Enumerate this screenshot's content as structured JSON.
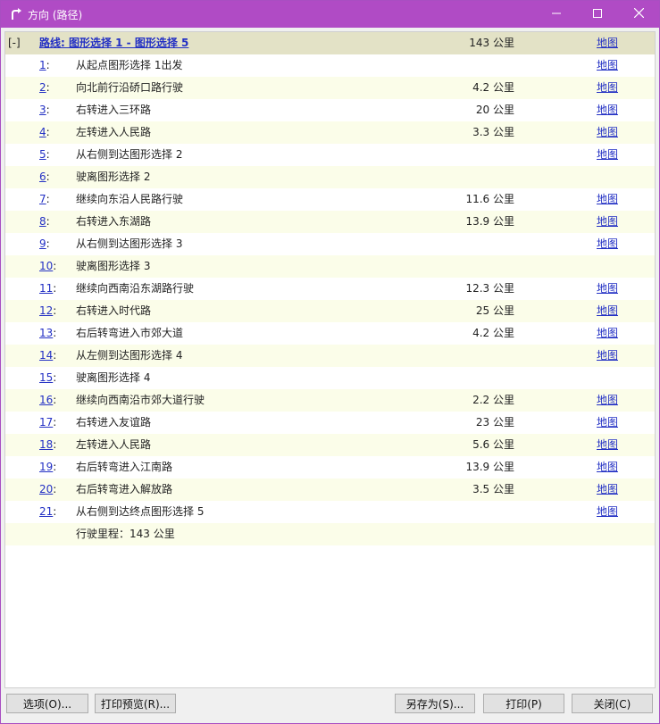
{
  "window": {
    "title": "方向 (路径)",
    "accent_color": "#b04bc5",
    "icons": {
      "app": "turn-arrow-icon",
      "minimize": "minimize-icon",
      "maximize": "maximize-icon",
      "close": "close-icon"
    }
  },
  "route": {
    "toggle": "[-]",
    "title": "路线: 图形选择 1 - 图形选择 5",
    "distance": "143 公里",
    "map_label": "地图"
  },
  "steps": [
    {
      "num": "1",
      "text": "从起点图形选择 1出发",
      "dist": "",
      "map": "地图"
    },
    {
      "num": "2",
      "text": "向北前行沿硚口路行驶",
      "dist": "4.2 公里",
      "map": "地图"
    },
    {
      "num": "3",
      "text": "右转进入三环路",
      "dist": "20 公里",
      "map": "地图"
    },
    {
      "num": "4",
      "text": "左转进入人民路",
      "dist": "3.3 公里",
      "map": "地图"
    },
    {
      "num": "5",
      "text": "从右侧到达图形选择 2",
      "dist": "",
      "map": "地图"
    },
    {
      "num": "6",
      "text": "驶离图形选择 2",
      "dist": "",
      "map": ""
    },
    {
      "num": "7",
      "text": "继续向东沿人民路行驶",
      "dist": "11.6 公里",
      "map": "地图"
    },
    {
      "num": "8",
      "text": "右转进入东湖路",
      "dist": "13.9 公里",
      "map": "地图"
    },
    {
      "num": "9",
      "text": "从右侧到达图形选择 3",
      "dist": "",
      "map": "地图"
    },
    {
      "num": "10",
      "text": "驶离图形选择 3",
      "dist": "",
      "map": ""
    },
    {
      "num": "11",
      "text": "继续向西南沿东湖路行驶",
      "dist": "12.3 公里",
      "map": "地图"
    },
    {
      "num": "12",
      "text": "右转进入时代路",
      "dist": "25 公里",
      "map": "地图"
    },
    {
      "num": "13",
      "text": "右后转弯进入市郊大道",
      "dist": "4.2 公里",
      "map": "地图"
    },
    {
      "num": "14",
      "text": "从左侧到达图形选择 4",
      "dist": "",
      "map": "地图"
    },
    {
      "num": "15",
      "text": "驶离图形选择 4",
      "dist": "",
      "map": ""
    },
    {
      "num": "16",
      "text": "继续向西南沿市郊大道行驶",
      "dist": "2.2 公里",
      "map": "地图"
    },
    {
      "num": "17",
      "text": "右转进入友谊路",
      "dist": "23 公里",
      "map": "地图"
    },
    {
      "num": "18",
      "text": "左转进入人民路",
      "dist": "5.6 公里",
      "map": "地图"
    },
    {
      "num": "19",
      "text": "右后转弯进入江南路",
      "dist": "13.9 公里",
      "map": "地图"
    },
    {
      "num": "20",
      "text": "右后转弯进入解放路",
      "dist": "3.5 公里",
      "map": "地图"
    },
    {
      "num": "21",
      "text": "从右侧到达终点图形选择 5",
      "dist": "",
      "map": "地图"
    }
  ],
  "summary": "行驶里程：143 公里",
  "buttons": {
    "options": "选项(O)...",
    "print_preview": "打印预览(R)...",
    "save_as": "另存为(S)...",
    "print": "打印(P)",
    "close": "关闭(C)"
  }
}
